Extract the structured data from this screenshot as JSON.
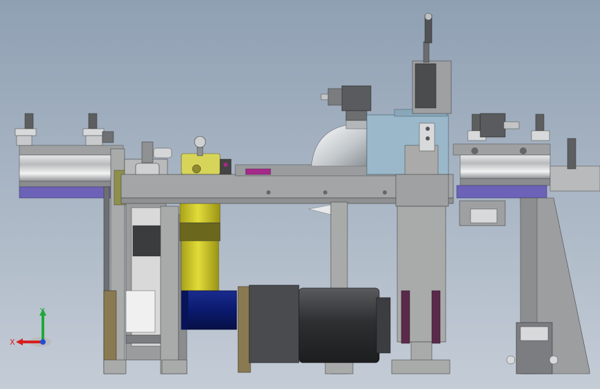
{
  "view": {
    "background_top": "#8fa0b3",
    "background_bottom": "#c4ccd6"
  },
  "triad": {
    "x_label": "X",
    "y_label": "Y",
    "x_color": "#d81e1e",
    "y_color": "#1fa83a",
    "z_color": "#2050d8"
  },
  "colors": {
    "steel": "#a9abaa",
    "steel_dark": "#7c7e80",
    "yellow": "#c9c220",
    "blue_motor": "#0e1f7c",
    "purple_band": "#6c63b8",
    "magenta": "#a52a8a",
    "bronze": "#8a7a52",
    "olive": "#8e8f4a",
    "glass": "#9ab8c9",
    "dark_motor": "#3a3b3d",
    "maroon": "#5a2a4a"
  }
}
